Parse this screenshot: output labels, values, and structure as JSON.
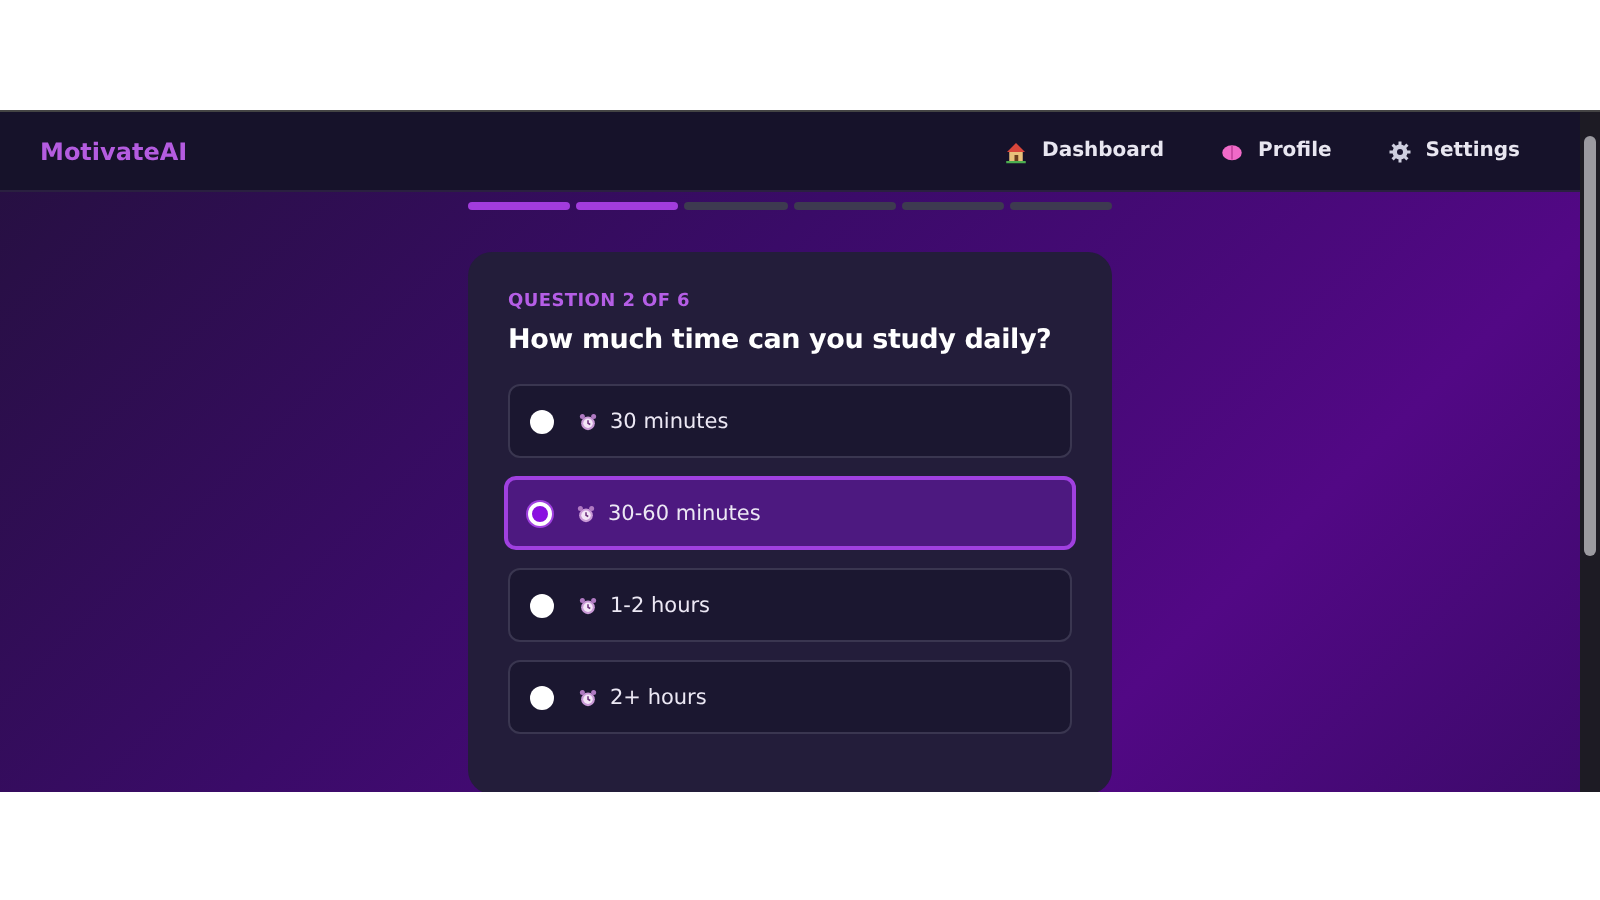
{
  "brand": "MotivateAI",
  "nav": [
    {
      "label": "Dashboard",
      "kind": "house"
    },
    {
      "label": "Profile",
      "kind": "brain"
    },
    {
      "label": "Settings",
      "kind": "gear"
    }
  ],
  "progress": [
    {
      "done": true
    },
    {
      "done": true
    },
    {
      "done": false
    },
    {
      "done": false
    },
    {
      "done": false
    },
    {
      "done": false
    }
  ],
  "question": {
    "counter": "QUESTION 2 OF 6",
    "title": "How much time can you study daily?"
  },
  "options": [
    {
      "label": "30 minutes",
      "selected": false
    },
    {
      "label": "30-60 minutes",
      "selected": true
    },
    {
      "label": "1-2 hours",
      "selected": false
    },
    {
      "label": "2+ hours",
      "selected": false
    }
  ]
}
